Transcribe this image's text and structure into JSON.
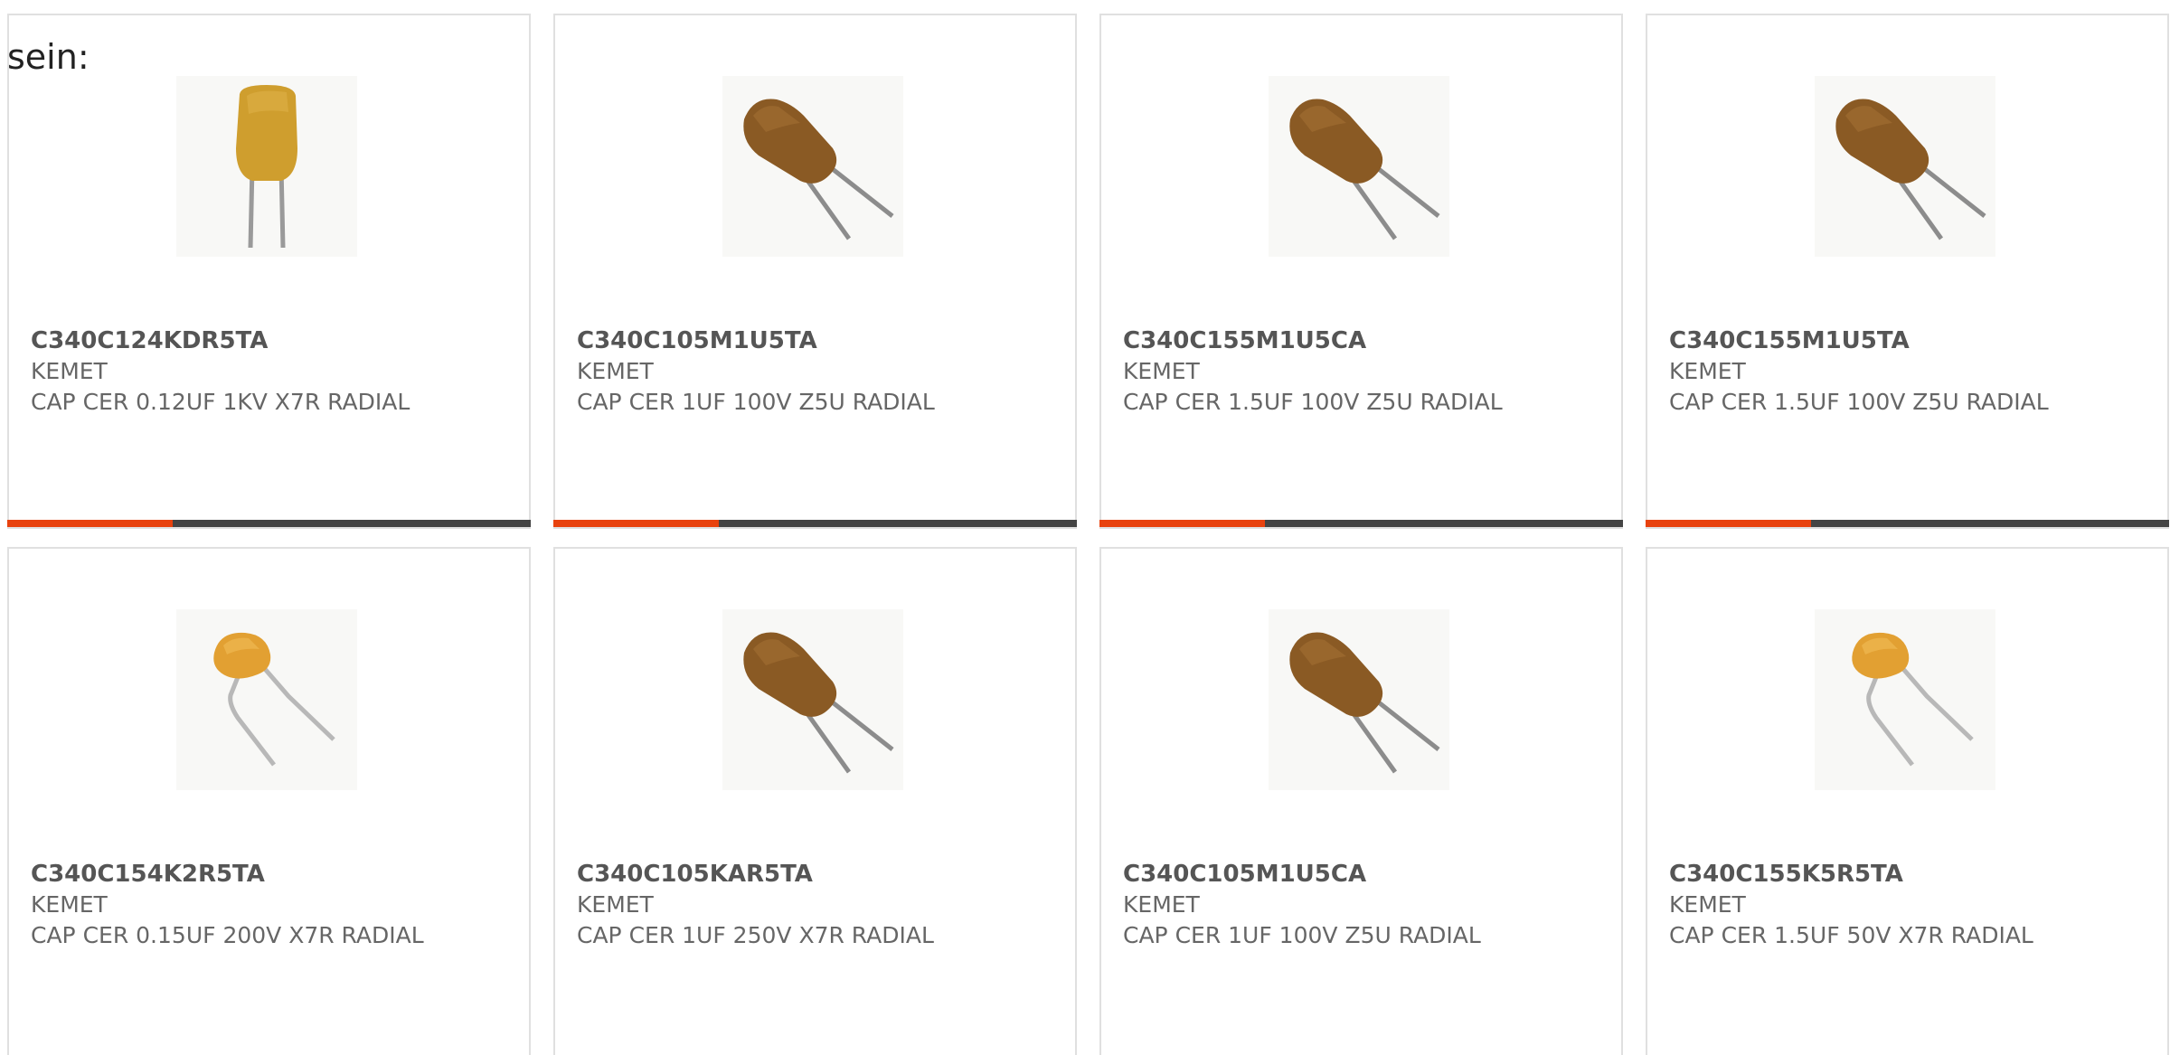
{
  "intro_text": "sein:",
  "colors": {
    "bar_accent": "#e8420e",
    "bar_rest": "#444444"
  },
  "products": [
    {
      "part_number": "C340C124KDR5TA",
      "manufacturer": "KEMET",
      "description": "CAP CER 0.12UF 1KV X7R RADIAL",
      "image": "upright-yellow-capacitor-icon",
      "has_bar": true
    },
    {
      "part_number": "C340C105M1U5TA",
      "manufacturer": "KEMET",
      "description": "CAP CER 1UF 100V Z5U RADIAL",
      "image": "brown-radial-capacitor-icon",
      "has_bar": true
    },
    {
      "part_number": "C340C155M1U5CA",
      "manufacturer": "KEMET",
      "description": "CAP CER 1.5UF 100V Z5U RADIAL",
      "image": "brown-radial-capacitor-icon",
      "has_bar": true
    },
    {
      "part_number": "C340C155M1U5TA",
      "manufacturer": "KEMET",
      "description": "CAP CER 1.5UF 100V Z5U RADIAL",
      "image": "brown-radial-capacitor-icon",
      "has_bar": true
    },
    {
      "part_number": "C340C154K2R5TA",
      "manufacturer": "KEMET",
      "description": "CAP CER 0.15UF 200V X7R RADIAL",
      "image": "small-orange-capacitor-icon",
      "has_bar": false
    },
    {
      "part_number": "C340C105KAR5TA",
      "manufacturer": "KEMET",
      "description": "CAP CER 1UF 250V X7R RADIAL",
      "image": "brown-radial-capacitor-icon",
      "has_bar": false
    },
    {
      "part_number": "C340C105M1U5CA",
      "manufacturer": "KEMET",
      "description": "CAP CER 1UF 100V Z5U RADIAL",
      "image": "brown-radial-capacitor-icon",
      "has_bar": false
    },
    {
      "part_number": "C340C155K5R5TA",
      "manufacturer": "KEMET",
      "description": "CAP CER 1.5UF 50V X7R RADIAL",
      "image": "small-orange-capacitor-icon",
      "has_bar": false
    }
  ]
}
